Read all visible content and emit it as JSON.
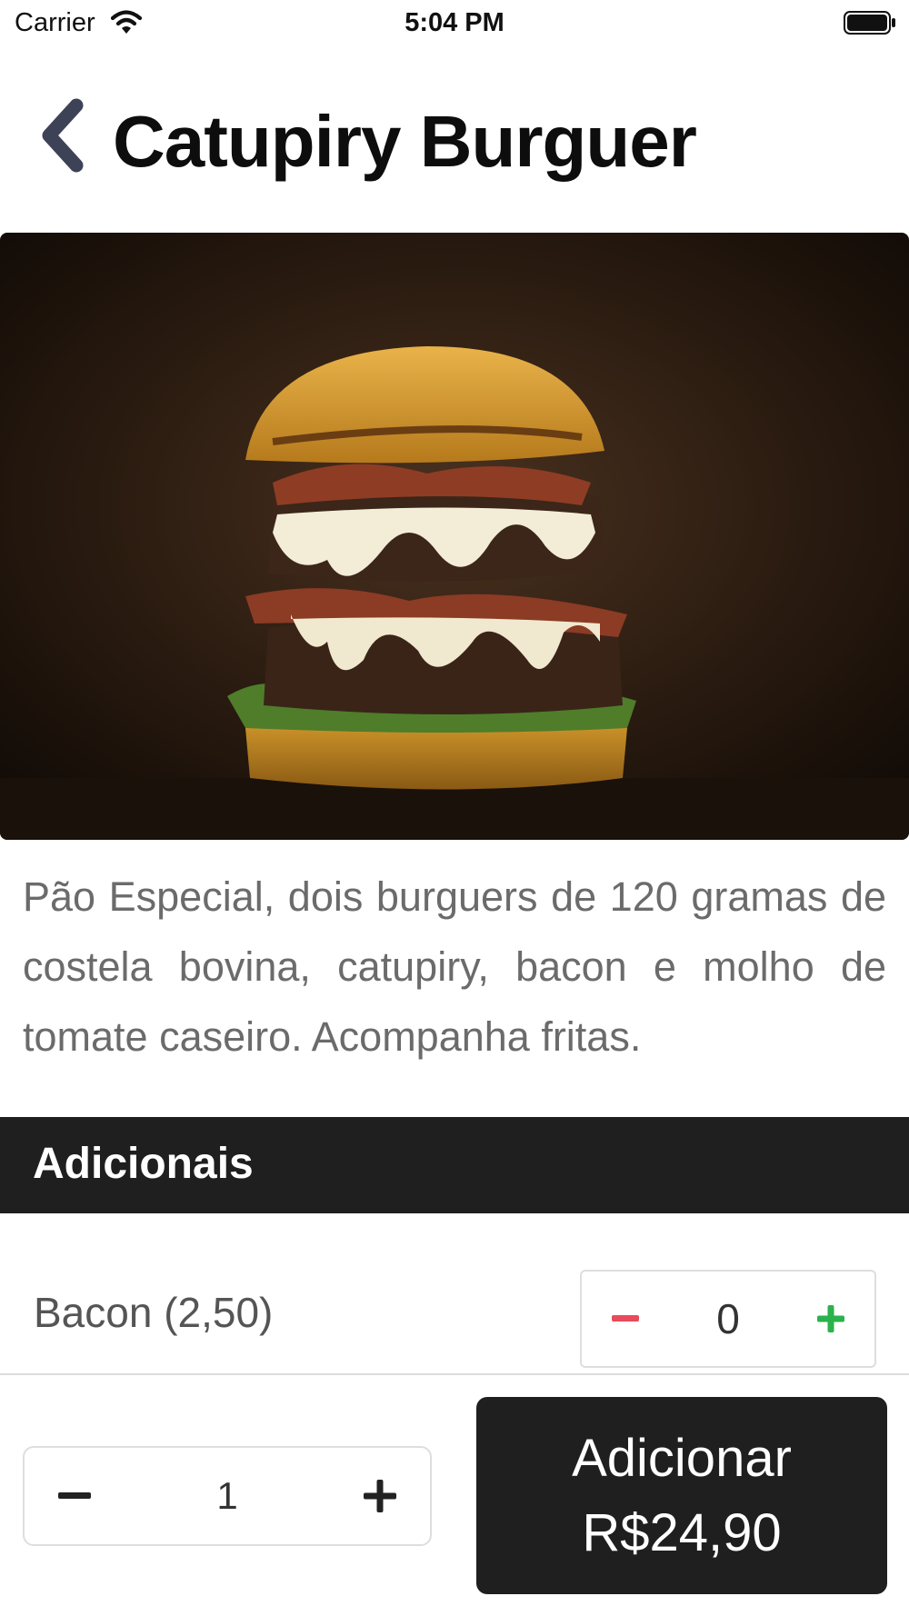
{
  "status_bar": {
    "carrier": "Carrier",
    "time": "5:04 PM",
    "icons": [
      "wifi-icon",
      "battery-icon"
    ]
  },
  "header": {
    "back_icon": "chevron-left-icon",
    "title": "Catupiry Burguer"
  },
  "product": {
    "image": "burger-photo",
    "description": "Pão Especial, dois burguers de 120 gramas de costela bovina, catupiry, bacon e molho de tomate caseiro. Acompanha fritas."
  },
  "extras": {
    "title": "Adicionais",
    "items": [
      {
        "label": "Bacon (2,50)",
        "quantity": "0",
        "minus_icon": "minus-icon",
        "plus_icon": "plus-icon"
      }
    ]
  },
  "footer": {
    "quantity": "1",
    "add_button": {
      "line1": "Adicionar",
      "line2": "R$24,90"
    }
  },
  "colors": {
    "dark": "#1f1f1f",
    "minus_red": "#e84b5b",
    "plus_green": "#2bb24c",
    "back_icon": "#3d4257",
    "description_text": "#6b6b6b"
  }
}
